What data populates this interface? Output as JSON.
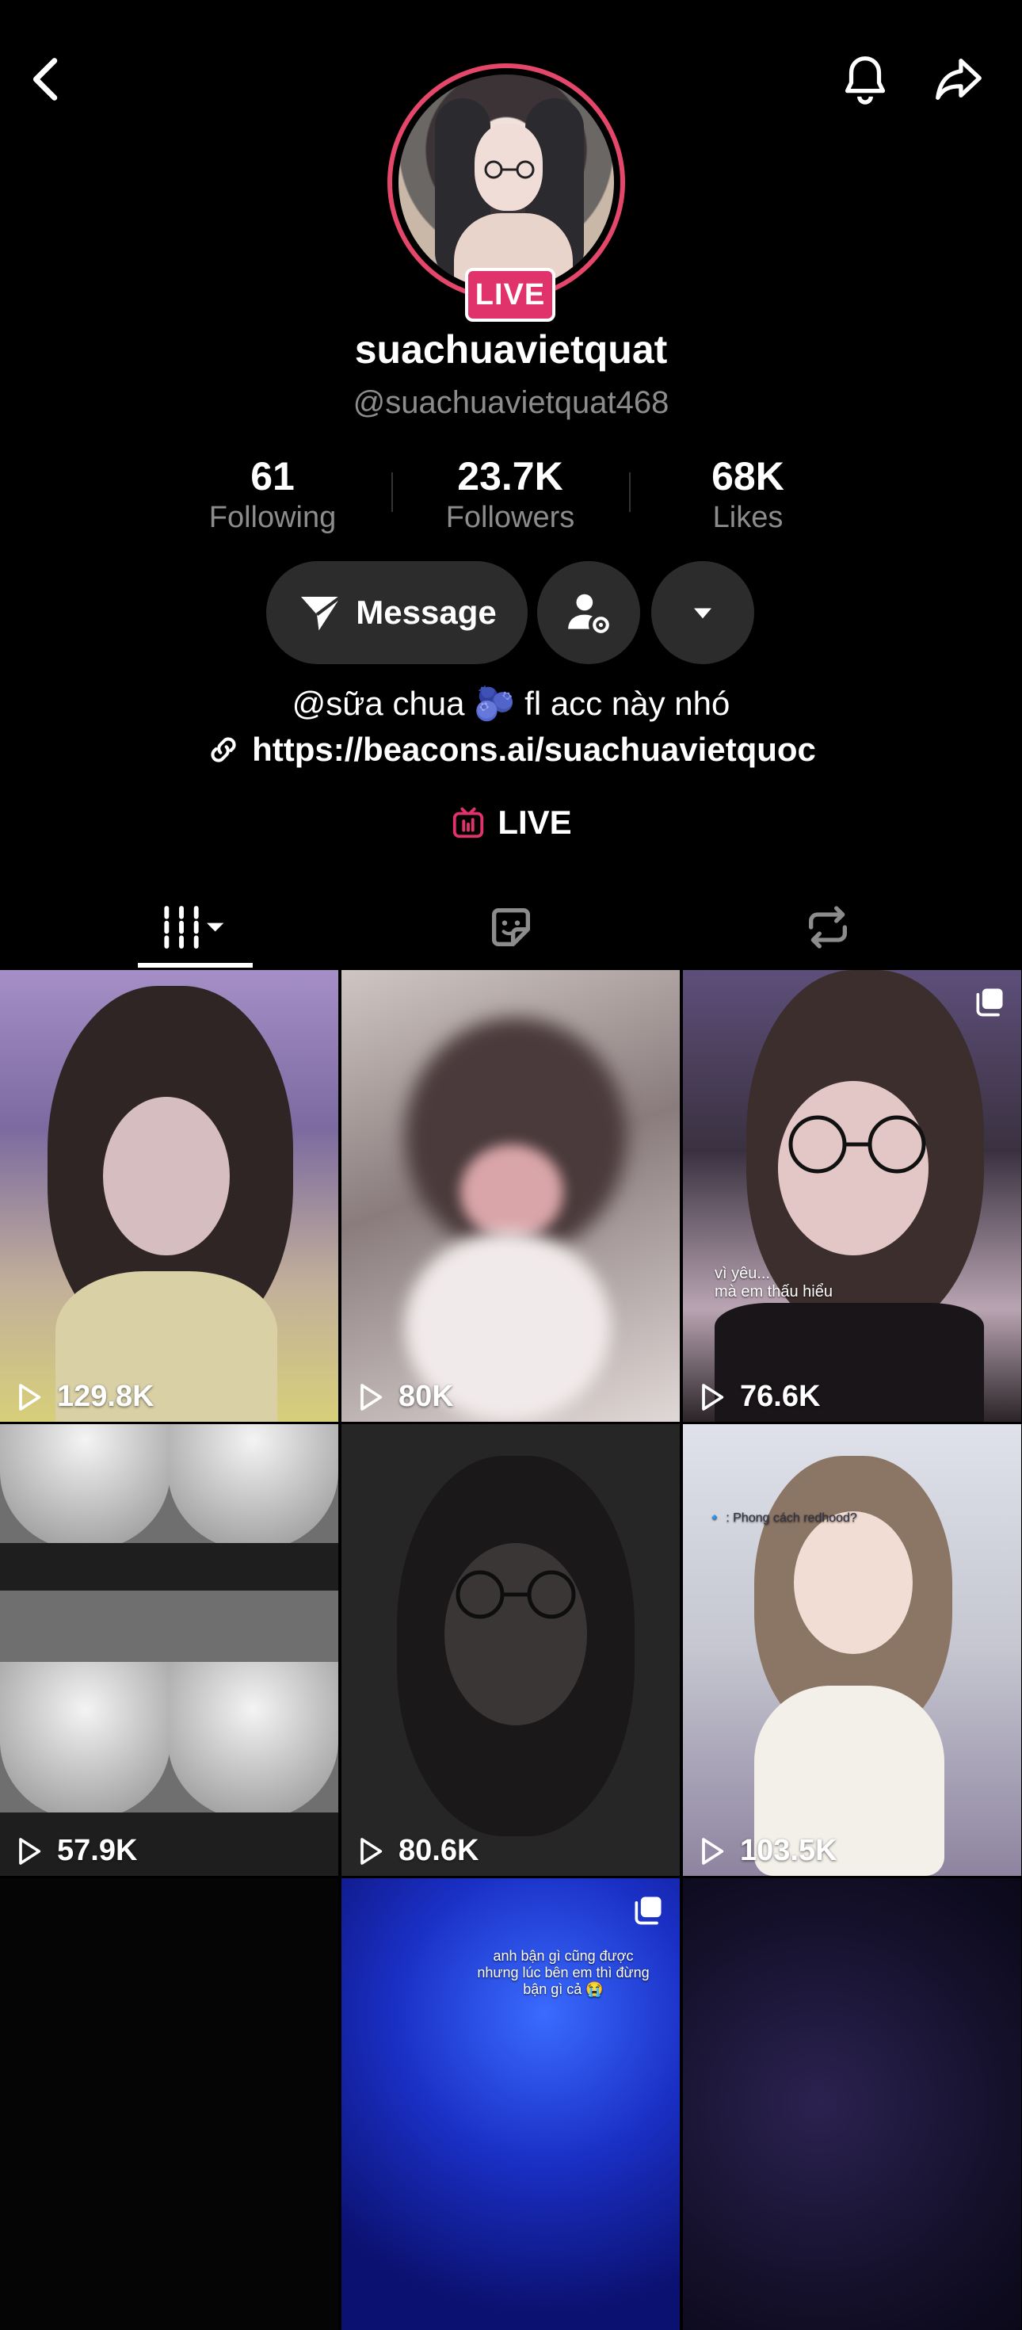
{
  "profile": {
    "display_name": "suachuavietquat",
    "handle": "@suachuavietquat468",
    "live_badge": "LIVE"
  },
  "stats": [
    {
      "value": "61",
      "label": "Following"
    },
    {
      "value": "23.7K",
      "label": "Followers"
    },
    {
      "value": "68K",
      "label": "Likes"
    }
  ],
  "actions": {
    "message_label": "Message"
  },
  "bio": {
    "text": "@sữa chua 🫐 fl acc này nhó",
    "link": "https://beacons.ai/suachuavietquoc",
    "live_label": "LIVE"
  },
  "colors": {
    "accent": "#e0336b",
    "background": "#000000",
    "button_bg": "#2c2c2c",
    "secondary_text": "#8c8c8c"
  },
  "icons": {
    "back": "chevron-left-icon",
    "notifications": "bell-icon",
    "share": "share-arrow-icon",
    "message": "paper-plane-icon",
    "friends": "person-gear-icon",
    "more": "caret-down-icon",
    "link": "link-icon",
    "live": "tv-icon"
  },
  "tabs": [
    {
      "name": "videos-grid-icon",
      "active": true
    },
    {
      "name": "stickers-icon",
      "active": false
    },
    {
      "name": "reposts-icon",
      "active": false
    }
  ],
  "videos": [
    {
      "views": "129.8K"
    },
    {
      "views": "80K"
    },
    {
      "views": "76.6K",
      "caption": "vì yêu...\nmà em thấu hiểu"
    },
    {
      "views": "57.9K"
    },
    {
      "views": "80.6K"
    },
    {
      "views": "103.5K",
      "caption": "🔹 : Phong cách redhood?"
    },
    {
      "views": ""
    },
    {
      "views": "",
      "caption": "anh bận gì cũng được\nnhưng lúc bên em thì đừng\nbận gì cả 😭"
    },
    {
      "views": ""
    }
  ]
}
